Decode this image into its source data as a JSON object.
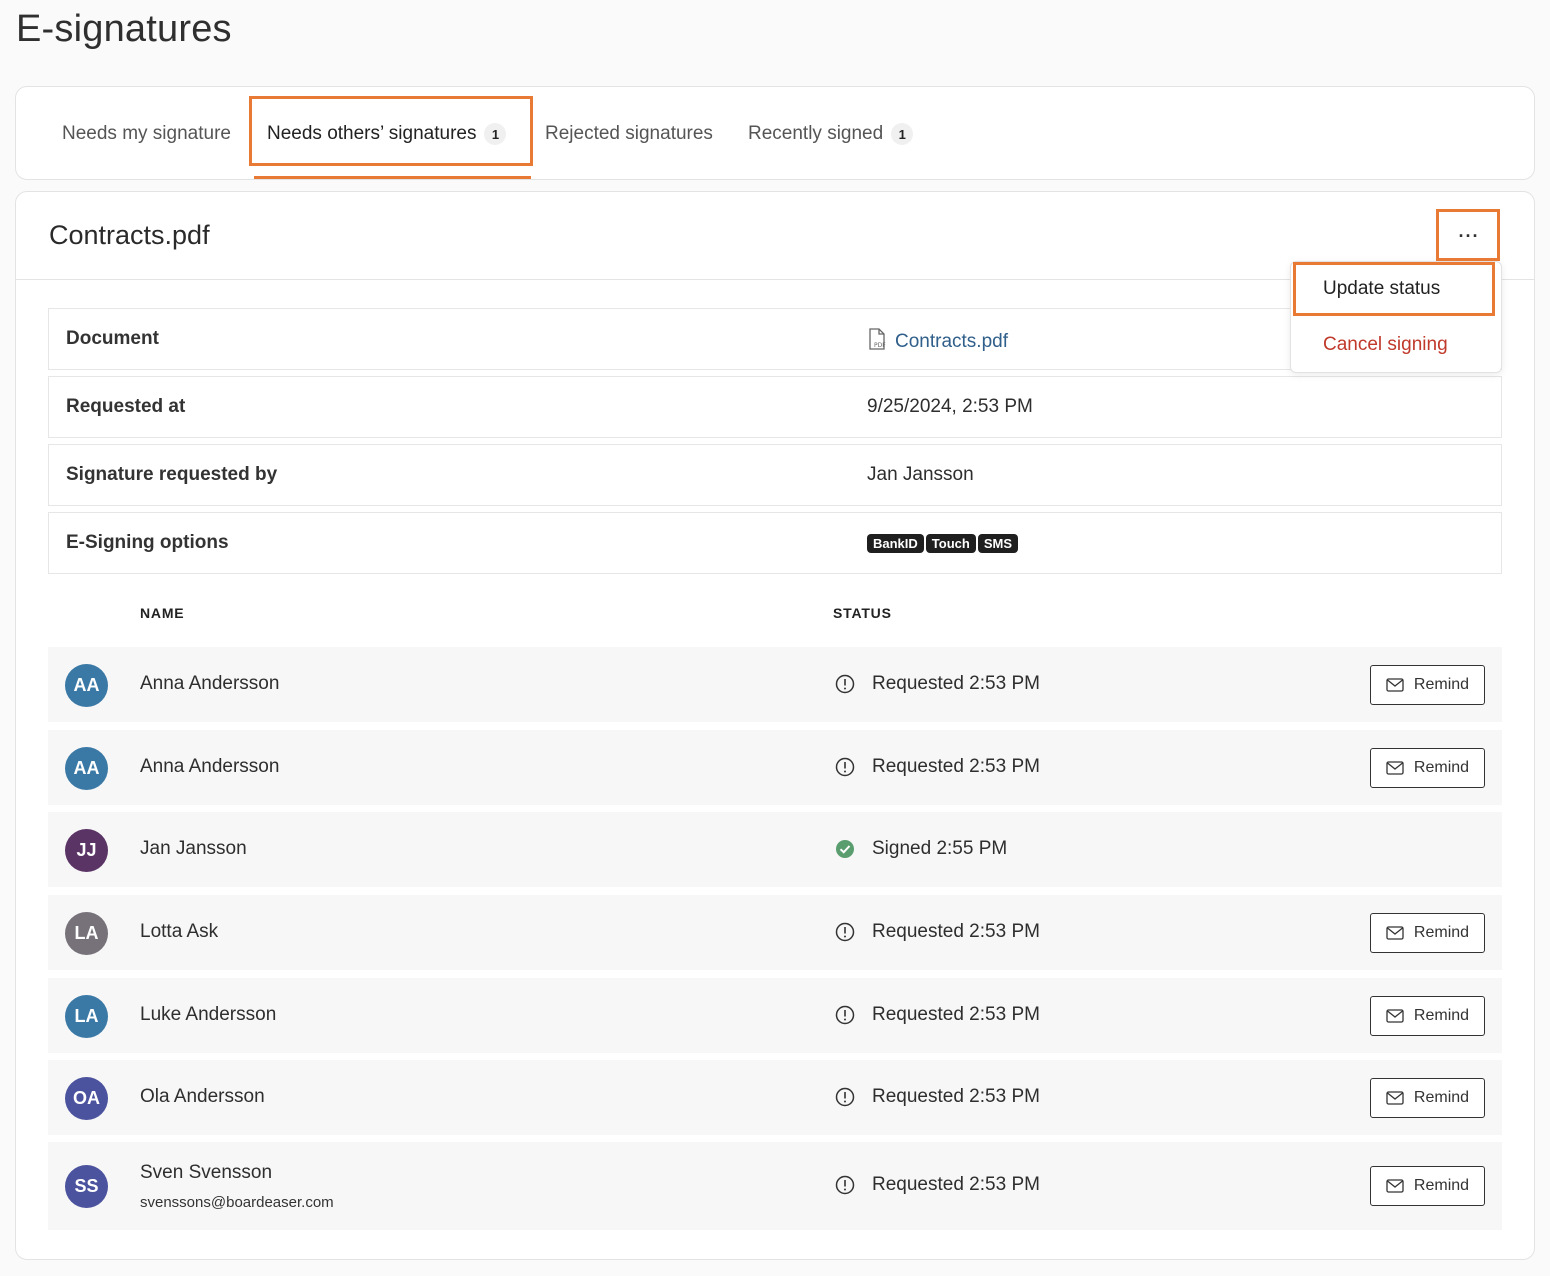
{
  "page": {
    "title": "E-signatures"
  },
  "tabs": [
    {
      "label": "Needs my signature",
      "badge": ""
    },
    {
      "label": "Needs others’ signatures",
      "badge": "1"
    },
    {
      "label": "Rejected signatures",
      "badge": ""
    },
    {
      "label": "Recently signed",
      "badge": "1"
    }
  ],
  "document": {
    "title": "Contracts.pdf",
    "more_label": "···",
    "menu": {
      "update_status": "Update status",
      "cancel_signing": "Cancel signing"
    },
    "info": {
      "document_label": "Document",
      "document_value": "Contracts.pdf",
      "requested_at_label": "Requested at",
      "requested_at_value": "9/25/2024, 2:53 PM",
      "requested_by_label": "Signature requested by",
      "requested_by_value": "Jan Jansson",
      "options_label": "E-Signing options",
      "options": [
        "BankID",
        "Touch",
        "SMS"
      ]
    }
  },
  "table": {
    "name_header": "NAME",
    "status_header": "STATUS",
    "remind_label": "Remind",
    "rows": [
      {
        "initials": "AA",
        "name": "Anna Andersson",
        "email": "",
        "status": "Requested 2:53 PM",
        "state": "requested",
        "color": "#3a79a6"
      },
      {
        "initials": "AA",
        "name": "Anna Andersson",
        "email": "",
        "status": "Requested 2:53 PM",
        "state": "requested",
        "color": "#3a79a6"
      },
      {
        "initials": "JJ",
        "name": "Jan Jansson",
        "email": "",
        "status": "Signed 2:55 PM",
        "state": "signed",
        "color": "#5b3466"
      },
      {
        "initials": "LA",
        "name": "Lotta Ask",
        "email": "",
        "status": "Requested 2:53 PM",
        "state": "requested",
        "color": "#77727a"
      },
      {
        "initials": "LA",
        "name": "Luke Andersson",
        "email": "",
        "status": "Requested 2:53 PM",
        "state": "requested",
        "color": "#3a79a6"
      },
      {
        "initials": "OA",
        "name": "Ola Andersson",
        "email": "",
        "status": "Requested 2:53 PM",
        "state": "requested",
        "color": "#4b529e"
      },
      {
        "initials": "SS",
        "name": "Sven Svensson",
        "email": "svenssons@boardeaser.com",
        "status": "Requested 2:53 PM",
        "state": "requested",
        "color": "#4b529e"
      }
    ]
  },
  "colors": {
    "accent": "#e87a35",
    "link": "#2f5f8a",
    "danger": "#c0392b",
    "success": "#5a9e6f"
  }
}
